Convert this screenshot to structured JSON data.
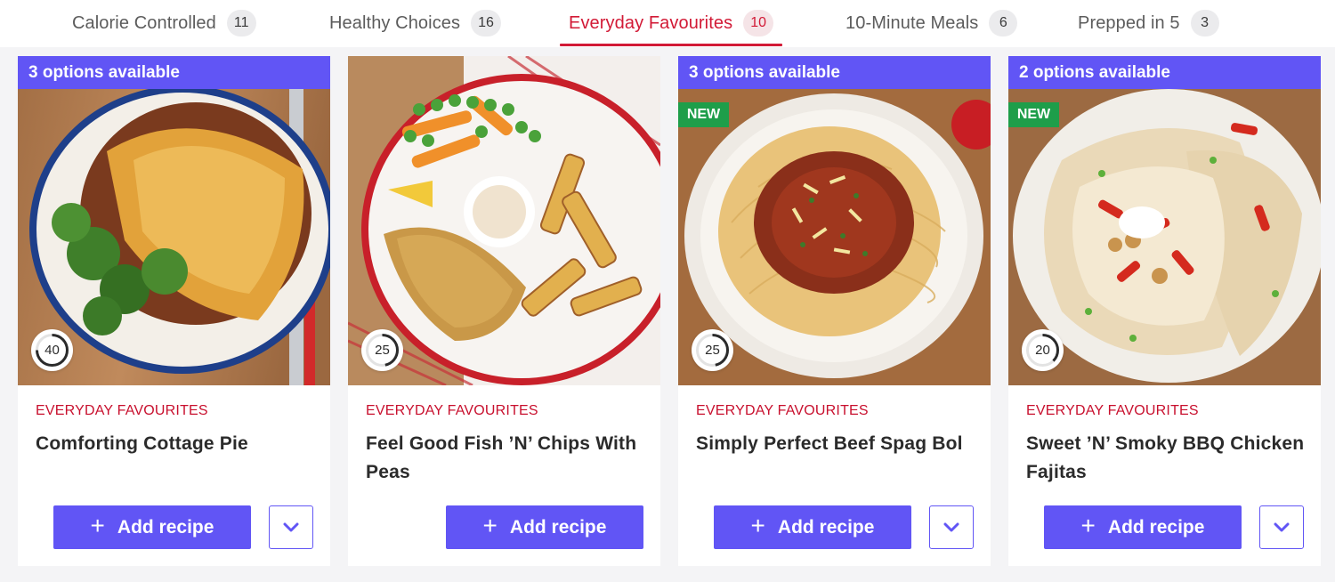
{
  "tabs": [
    {
      "label": "Calorie Controlled",
      "count": "11"
    },
    {
      "label": "Healthy Choices",
      "count": "16"
    },
    {
      "label": "Everyday Favourites",
      "count": "10"
    },
    {
      "label": "10-Minute Meals",
      "count": "6"
    },
    {
      "label": "Prepped in 5",
      "count": "3"
    }
  ],
  "active_tab": "Everyday Favourites",
  "colors": {
    "accent": "#6155f5",
    "active_tab": "#d21a36",
    "category": "#c8102e",
    "new_badge": "#1e9e4a"
  },
  "cards": [
    {
      "options": "3 options available",
      "badge": "",
      "time": "40",
      "category": "EVERYDAY FAVOURITES",
      "title": "Comforting Cottage Pie",
      "add_label": "Add recipe",
      "has_expand": true,
      "image": "cottage-pie-photo"
    },
    {
      "options": "",
      "badge": "",
      "time": "25",
      "category": "EVERYDAY FAVOURITES",
      "title": "Feel Good Fish ’N’ Chips With Peas",
      "add_label": "Add recipe",
      "has_expand": false,
      "image": "fish-and-chips-photo"
    },
    {
      "options": "3 options available",
      "badge": "NEW",
      "time": "25",
      "category": "EVERYDAY FAVOURITES",
      "title": "Simply Perfect Beef Spag Bol",
      "add_label": "Add recipe",
      "has_expand": true,
      "image": "spaghetti-bolognese-photo"
    },
    {
      "options": "2 options available",
      "badge": "NEW",
      "time": "20",
      "category": "EVERYDAY FAVOURITES",
      "title": "Sweet ’N’ Smoky BBQ Chicken Fajitas",
      "add_label": "Add recipe",
      "has_expand": true,
      "image": "chicken-fajitas-photo"
    }
  ],
  "icons": {
    "add": "plus-icon",
    "expand": "chevron-down-icon",
    "timer": "timer-ring-icon"
  }
}
